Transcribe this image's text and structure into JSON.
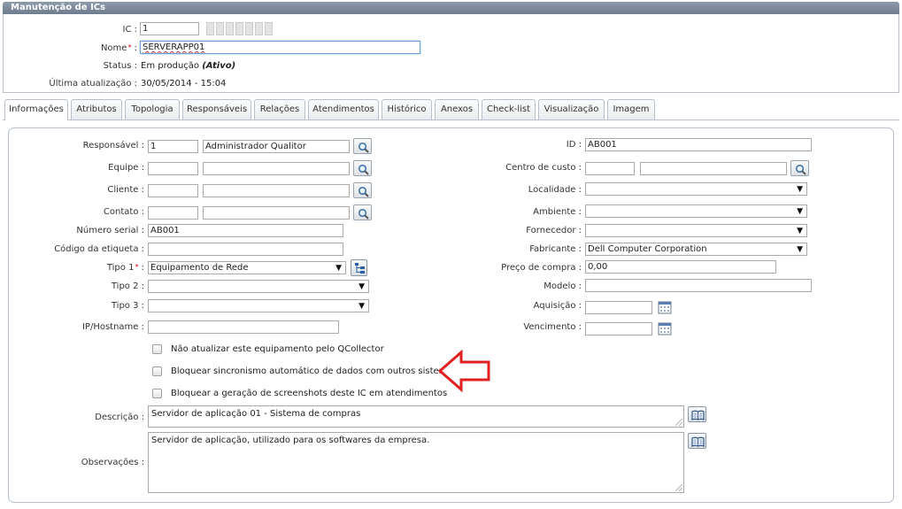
{
  "window": {
    "title": "Manutenção de ICs"
  },
  "header": {
    "ic_label": "IC :",
    "ic_value": "1",
    "name_label": "Nome",
    "name_suffix": ":",
    "name_value": "SERVERAPP01",
    "status_label": "Status :",
    "status_value": "Em produção",
    "status_extra": "(Ativo)",
    "last_update_label": "Última atualização :",
    "last_update_value": "30/05/2014 - 15:04"
  },
  "required_mark": "*",
  "tabs": [
    "Informações",
    "Atributos",
    "Topologia",
    "Responsáveis",
    "Relações",
    "Atendimentos",
    "Histórico",
    "Anexos",
    "Check-list",
    "Visualização",
    "Imagem"
  ],
  "active_tab": "Informações",
  "left_form": {
    "responsavel": {
      "label": "Responsável :",
      "code": "1",
      "name": "Administrador Qualitor"
    },
    "equipe": {
      "label": "Equipe :",
      "code": "",
      "name": ""
    },
    "cliente": {
      "label": "Cliente :",
      "code": "",
      "name": ""
    },
    "contato": {
      "label": "Contato :",
      "code": "",
      "name": ""
    },
    "numero_serial": {
      "label": "Número serial :",
      "value": "AB001"
    },
    "codigo_etiqueta": {
      "label": "Código da etiqueta :",
      "value": ""
    },
    "tipo1": {
      "label": "Tipo 1",
      "suffix": ":",
      "value": "Equipamento de Rede"
    },
    "tipo2": {
      "label": "Tipo 2 :",
      "value": ""
    },
    "tipo3": {
      "label": "Tipo 3 :",
      "value": ""
    },
    "ip_hostname": {
      "label": "IP/Hostname :",
      "value": ""
    }
  },
  "right_form": {
    "id": {
      "label": "ID :",
      "value": "AB001"
    },
    "centro_custo": {
      "label": "Centro de custo :",
      "code": "",
      "name": ""
    },
    "localidade": {
      "label": "Localidade :",
      "value": ""
    },
    "ambiente": {
      "label": "Ambiente :",
      "value": ""
    },
    "fornecedor": {
      "label": "Fornecedor :",
      "value": ""
    },
    "fabricante": {
      "label": "Fabricante :",
      "value": "Dell Computer Corporation"
    },
    "preco_compra": {
      "label": "Preço de compra :",
      "value": "0,00"
    },
    "modelo": {
      "label": "Modelo :",
      "value": ""
    },
    "aquisicao": {
      "label": "Aquisição :",
      "value": ""
    },
    "vencimento": {
      "label": "Vencimento :",
      "value": ""
    }
  },
  "checkboxes": [
    {
      "label": "Não atualizar este equipamento pelo QCollector",
      "checked": false
    },
    {
      "label": "Bloquear sincronismo automático de dados com outros sistemas",
      "checked": false
    },
    {
      "label": "Bloquear a geração de screenshots deste IC em atendimentos",
      "checked": false
    }
  ],
  "descricao": {
    "label": "Descrição :",
    "value": "Servidor de aplicação 01 - Sistema de compras"
  },
  "observacoes": {
    "label": "Observações :",
    "value": "Servidor de aplicação, utilizado para os softwares da empresa."
  },
  "icons": {
    "search": "magnifier-icon",
    "tree": "tree-icon",
    "calendar": "calendar-icon",
    "book": "book-icon",
    "dropdown": "chevron-down-icon",
    "annotation": "red-arrow-icon"
  },
  "colors": {
    "titlebar": "#7b8899",
    "annotation_arrow": "#e02020",
    "border": "#b7c0cb"
  }
}
